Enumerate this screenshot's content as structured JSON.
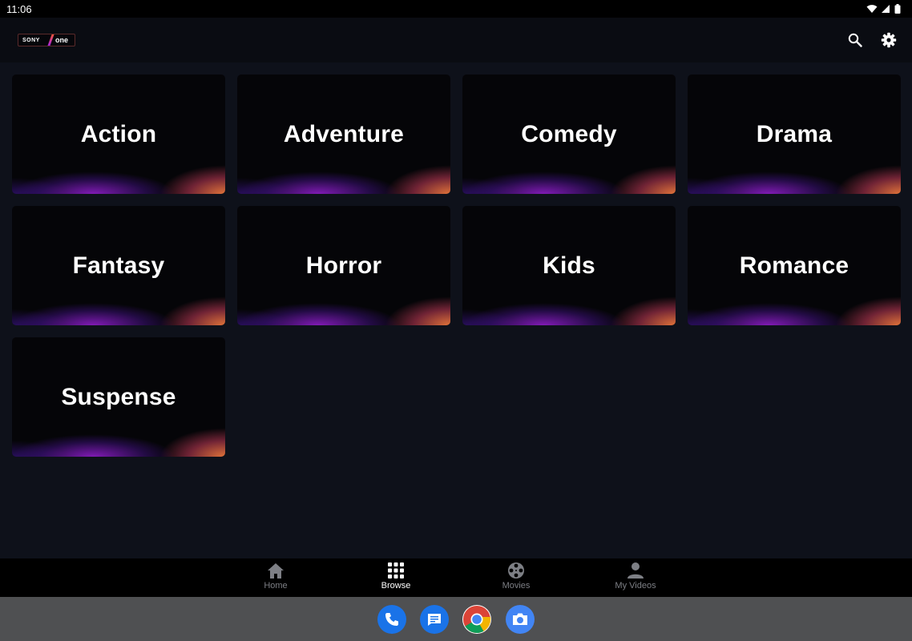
{
  "status_bar": {
    "time": "11:06",
    "icons": [
      "wifi-icon",
      "signal-icon",
      "battery-icon"
    ]
  },
  "app_bar": {
    "logo_text_left": "SONY",
    "logo_text_right": "one",
    "actions": [
      "search-icon",
      "settings-gear-icon"
    ]
  },
  "genres": [
    {
      "label": "Action"
    },
    {
      "label": "Adventure"
    },
    {
      "label": "Comedy"
    },
    {
      "label": "Drama"
    },
    {
      "label": "Fantasy"
    },
    {
      "label": "Horror"
    },
    {
      "label": "Kids"
    },
    {
      "label": "Romance"
    },
    {
      "label": "Suspense"
    }
  ],
  "bottom_nav": {
    "active": "Browse",
    "items": [
      {
        "label": "Home",
        "icon": "home-icon"
      },
      {
        "label": "Browse",
        "icon": "grid-icon"
      },
      {
        "label": "Movies",
        "icon": "film-reel-icon"
      },
      {
        "label": "My Videos",
        "icon": "person-icon"
      }
    ]
  },
  "dock": {
    "apps": [
      "phone-icon",
      "messages-icon",
      "chrome-icon",
      "camera-icon"
    ]
  },
  "colors": {
    "background": "#0e111a",
    "app_bar": "#0a0c12",
    "nav_active": "#ffffff",
    "nav_inactive": "#7d7f85",
    "dock": "#4f5052",
    "dock_app_blue": "#1a73e8"
  }
}
